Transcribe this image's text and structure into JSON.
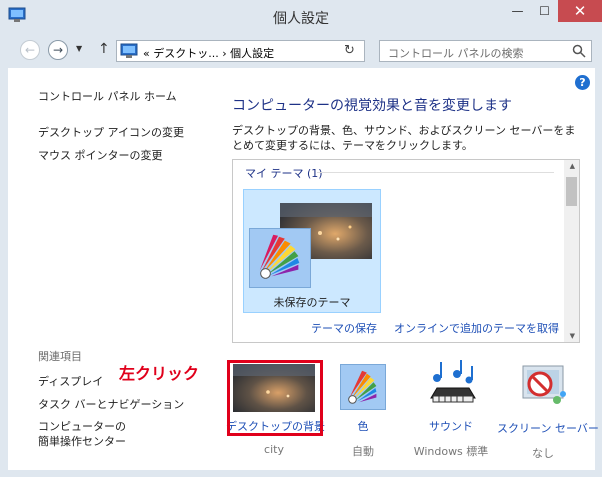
{
  "window": {
    "title": "個人設定"
  },
  "nav": {
    "breadcrumb": "« デスクトッ... › 個人設定",
    "search_placeholder": "コントロール パネルの検索"
  },
  "sidebar": {
    "home_link": "コントロール パネル ホーム",
    "links": [
      "デスクトップ アイコンの変更",
      "マウス ポインターの変更"
    ],
    "related_header": "関連項目",
    "related": [
      "ディスプレイ",
      "タスク バーとナビゲーション",
      "コンピューターの",
      "簡単操作センター"
    ]
  },
  "main": {
    "title": "コンピューターの視覚効果と音を変更します",
    "description": "デスクトップの背景、色、サウンド、およびスクリーン セーバーをまとめて変更するには、テーマをクリックします。",
    "themes_header": "マイ テーマ (1)",
    "theme_name": "未保存のテーマ",
    "save_theme": "テーマの保存",
    "get_more": "オンラインで追加のテーマを取得"
  },
  "bottom": [
    {
      "label": "デスクトップの背景",
      "sub": "city"
    },
    {
      "label": "色",
      "sub": "自動"
    },
    {
      "label": "サウンド",
      "sub": "Windows 標準"
    },
    {
      "label": "スクリーン セーバー",
      "sub": "なし"
    }
  ],
  "annotation": {
    "text": "左クリック",
    "color": "#e0001b"
  },
  "colors": {
    "accent": "#1e3287",
    "link": "#1e4fb6",
    "selected_tile": "#cce8ff",
    "close": "#c74b50"
  }
}
